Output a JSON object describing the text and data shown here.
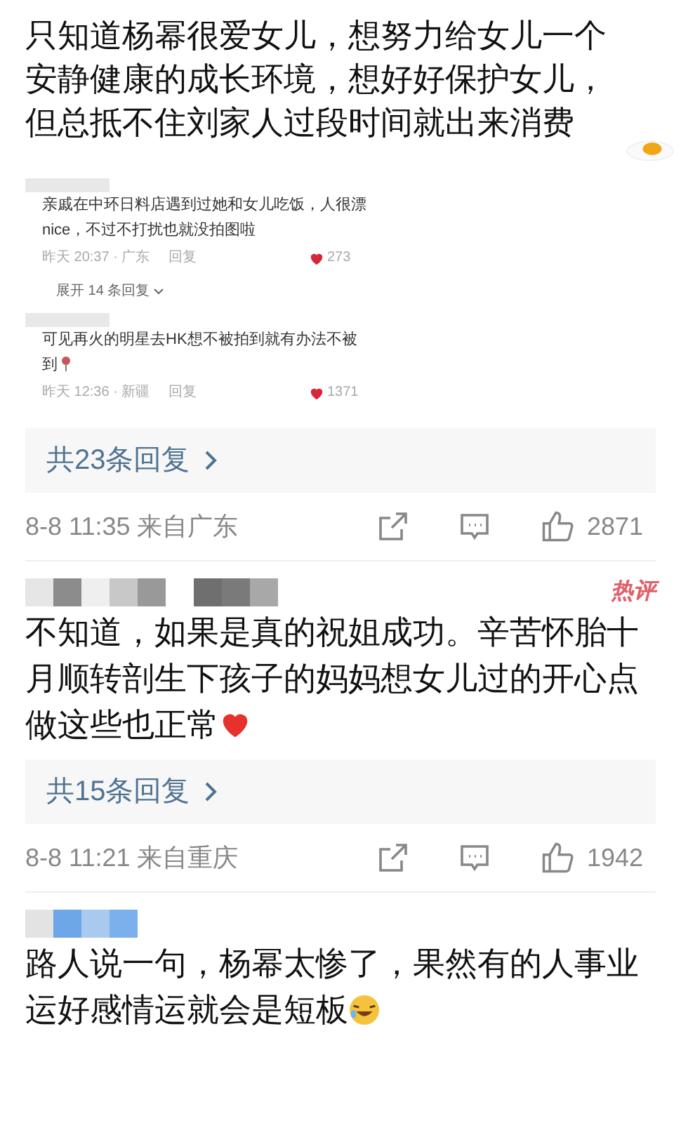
{
  "comments": [
    {
      "lines": [
        "只知道杨幂很爱女儿，想努力给女儿一个",
        "安静健康的成长环境，想好好保护女儿，",
        "但总抵不住刘家人过段时间就出来消费"
      ],
      "emoji": {
        "kind": "egg"
      },
      "quoted": [
        {
          "lines": [
            "亲戚在中环日料店遇到过她和女儿吃饭，人很漂",
            "nice，不过不打扰也就没拍图啦"
          ],
          "time": "昨天 20:37 · 广东",
          "reply": "回复",
          "likes": "273",
          "expand": "展开 14 条回复"
        },
        {
          "lines": [
            "可见再火的明星去HK想不被拍到就有办法不被",
            "到"
          ],
          "emoji": {
            "kind": "rose"
          },
          "time": "昨天 12:36 · 新疆",
          "reply": "回复",
          "likes": "1371"
        }
      ],
      "replies_link": "共23条回复",
      "time": "8-8 11:35 来自广东",
      "likes": "2871"
    },
    {
      "username": {
        "kind": "blurred_gray"
      },
      "badge": "热评",
      "lines": [
        "不知道，如果是真的祝姐成功。辛苦怀胎十",
        "月顺转剖生下孩子的妈妈想女儿过的开心点",
        "做这些也正常"
      ],
      "emoji": {
        "kind": "heart"
      },
      "replies_link": "共15条回复",
      "time": "8-8 11:21 来自重庆",
      "likes": "1942"
    },
    {
      "username": {
        "kind": "blurred_blue"
      },
      "lines": [
        "路人说一句，杨幂太惨了，果然有的人事业",
        "运好感情运就会是短板"
      ],
      "emoji": {
        "kind": "laughing"
      }
    }
  ]
}
